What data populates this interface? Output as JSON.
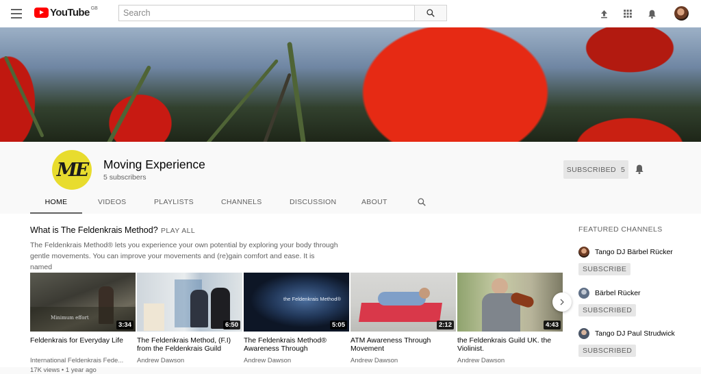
{
  "header": {
    "logo_text": "YouTube",
    "logo_region": "GB",
    "search_placeholder": "Search"
  },
  "channel": {
    "avatar_text": "ME",
    "title": "Moving Experience",
    "subscribers": "5 subscribers",
    "subscribed_label": "SUBSCRIBED",
    "subscribed_count": "5"
  },
  "tabs": [
    "HOME",
    "VIDEOS",
    "PLAYLISTS",
    "CHANNELS",
    "DISCUSSION",
    "ABOUT"
  ],
  "section": {
    "title": "What is The Feldenkrais Method?",
    "play_all": "PLAY ALL",
    "description_line1": "The Feldenkrais Method® lets you experience your own potential by exploring your body through",
    "description_line2": "gentle movements. You can improve your movements and (re)gain comfort and ease. It is named"
  },
  "videos": [
    {
      "title": "Feldenkrais for Everyday Life",
      "channel": "International Feldenkrais Fede...",
      "meta": "17K views • 1 year ago",
      "duration": "3:34",
      "overlay": "Minimum effort"
    },
    {
      "title": "The Feldenkrais Method, (F.I) from the Feldenkrais Guild",
      "channel": "Andrew Dawson",
      "meta": "",
      "duration": "6:50",
      "overlay": ""
    },
    {
      "title": "The Feldenkrais Method® Awareness Through",
      "channel": "Andrew Dawson",
      "meta": "",
      "duration": "5:05",
      "overlay": "the Feldenkrais Method®"
    },
    {
      "title": "ATM Awareness Through Movement",
      "channel": "Andrew Dawson",
      "meta": "",
      "duration": "2:12",
      "overlay": ""
    },
    {
      "title": "the Feldenkrais Guild UK. the Violinist.",
      "channel": "Andrew Dawson",
      "meta": "",
      "duration": "4:43",
      "overlay": ""
    }
  ],
  "featured": {
    "title": "FEATURED CHANNELS",
    "channels": [
      {
        "name": "Tango DJ Bärbel Rücker",
        "button": "SUBSCRIBE"
      },
      {
        "name": "Bärbel Rücker",
        "button": "SUBSCRIBED"
      },
      {
        "name": "Tango DJ Paul Strudwick",
        "button": "SUBSCRIBED"
      }
    ]
  }
}
